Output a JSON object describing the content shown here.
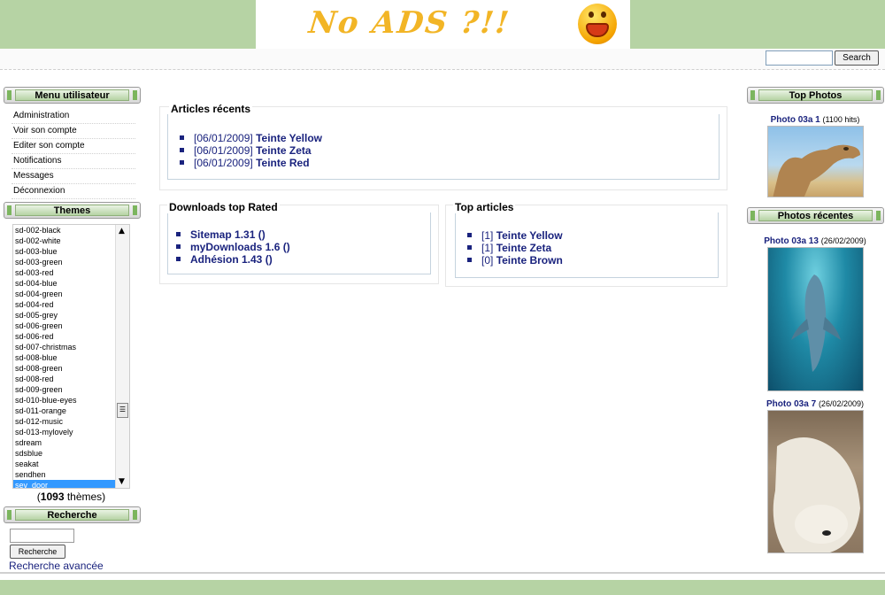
{
  "header": {
    "banner_text": "No ADS ?!!",
    "search": {
      "placeholder": "",
      "button_label": "Search"
    }
  },
  "left": {
    "user_menu": {
      "title": "Menu utilisateur",
      "items": [
        {
          "label": "Administration"
        },
        {
          "label": "Voir son compte"
        },
        {
          "label": "Editer son compte"
        },
        {
          "label": "Notifications"
        },
        {
          "label": "Messages"
        },
        {
          "label": "Déconnexion"
        }
      ]
    },
    "themes": {
      "title": "Themes",
      "options": [
        "sd-002-black",
        "sd-002-white",
        "sd-003-blue",
        "sd-003-green",
        "sd-003-red",
        "sd-004-blue",
        "sd-004-green",
        "sd-004-red",
        "sd-005-grey",
        "sd-006-green",
        "sd-006-red",
        "sd-007-christmas",
        "sd-008-blue",
        "sd-008-green",
        "sd-008-red",
        "sd-009-green",
        "sd-010-blue-eyes",
        "sd-011-orange",
        "sd-012-music",
        "sd-013-mylovely",
        "sdream",
        "sdsblue",
        "seakat",
        "sendhen",
        "sev_door"
      ],
      "selected": "sev_door",
      "count_open": "(",
      "count_value": "1093",
      "count_suffix": " thèmes)"
    },
    "search": {
      "title": "Recherche",
      "button_label": "Recherche",
      "advanced_label": "Recherche avancée"
    }
  },
  "center": {
    "recent_articles": {
      "title": "Articles récents",
      "items": [
        {
          "date": "[06/01/2009]",
          "name": "Teinte Yellow"
        },
        {
          "date": "[06/01/2009]",
          "name": "Teinte Zeta"
        },
        {
          "date": "[06/01/2009]",
          "name": "Teinte Red"
        }
      ]
    },
    "downloads_top_rated": {
      "title": "Downloads top Rated",
      "items": [
        {
          "name": "Sitemap 1.31 ()"
        },
        {
          "name": "myDownloads 1.6 ()"
        },
        {
          "name": "Adhésion 1.43 ()"
        }
      ]
    },
    "top_articles": {
      "title": "Top articles",
      "items": [
        {
          "count": "[1]",
          "name": "Teinte Yellow"
        },
        {
          "count": "[1]",
          "name": "Teinte Zeta"
        },
        {
          "count": "[0]",
          "name": "Teinte Brown"
        }
      ]
    }
  },
  "right": {
    "top_photos": {
      "title": "Top Photos",
      "photo": {
        "name": "Photo 03a 1",
        "meta": "(1100 hits)",
        "subject": "camel"
      }
    },
    "recent_photos": {
      "title": "Photos récentes",
      "photos": [
        {
          "name": "Photo 03a 13",
          "meta": "(26/02/2009)",
          "subject": "dolphin"
        },
        {
          "name": "Photo 03a 7",
          "meta": "(26/02/2009)",
          "subject": "polar-bear"
        }
      ]
    }
  },
  "colors": {
    "header_green": "#b6d3a4",
    "link_blue": "#1a237e",
    "selected_blue": "#3399ff",
    "banner_yellow": "#f2b526"
  }
}
